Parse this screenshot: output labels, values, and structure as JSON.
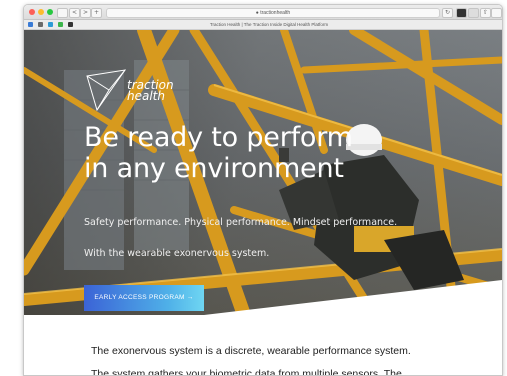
{
  "browser": {
    "url": "tractionhealth",
    "page_title": "Traction Health | The Traction Inside Digital Health Platform",
    "nav_back": "<",
    "nav_forward": ">",
    "new_tab": "+"
  },
  "hero": {
    "logo_line1": "traction",
    "logo_line2": "health",
    "headline_line1": "Be ready to perform",
    "headline_line2": "in any environment",
    "tagline": "Safety performance. Physical performance. Mindset performance.",
    "subtitle": "With the wearable exonervous system.",
    "cta_label": "EARLY ACCESS PROGRAM →"
  },
  "content": {
    "paragraph1": "The exonervous system is a discrete, wearable performance system.",
    "paragraph2": "The system gathers your biometric data from multiple sensors. The"
  },
  "colors": {
    "cta_start": "#3b63d6",
    "cta_end": "#6fd6f2",
    "crane_yellow": "#e0a020"
  }
}
